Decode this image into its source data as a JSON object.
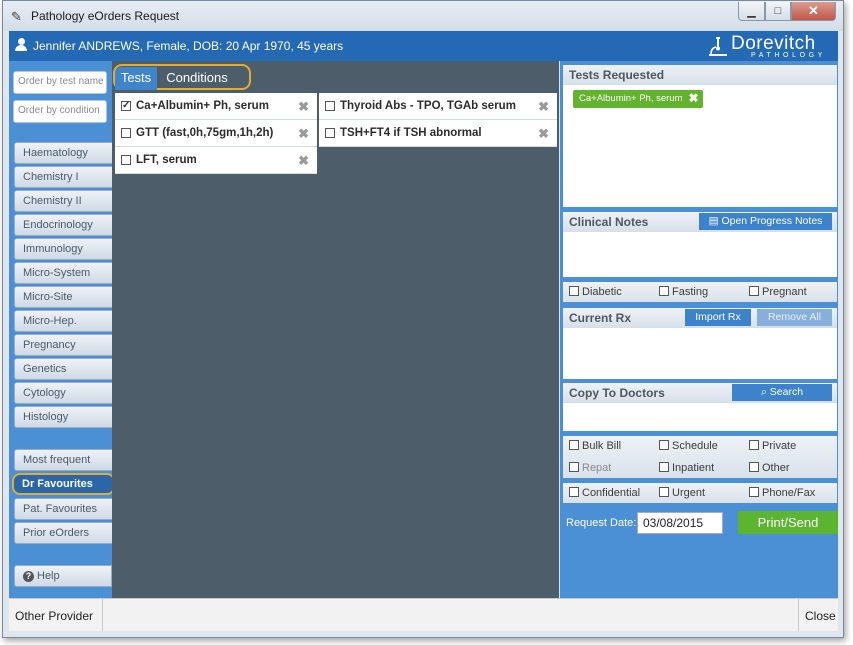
{
  "window": {
    "title": "Pathology eOrders Request",
    "minimize": "▁",
    "maximize": "□",
    "close": "✕"
  },
  "patient": {
    "summary": "Jennifer ANDREWS, Female, DOB: 20 Apr 1970, 45 years"
  },
  "logo": {
    "name": "Dorevitch",
    "sub": "PATHOLOGY"
  },
  "sidebar": {
    "search_test_placeholder": "Order by test name",
    "search_condition_placeholder": "Order by condition",
    "categories": [
      "Haematology",
      "Chemistry I",
      "Chemistry II",
      "Endocrinology",
      "Immunology",
      "Micro-System",
      "Micro-Site",
      "Micro-Hep.",
      "Pregnancy",
      "Genetics",
      "Cytology",
      "Histology"
    ],
    "lists": [
      "Most frequent",
      "Dr Favourites",
      "Pat. Favourites",
      "Prior eOrders"
    ],
    "active_list": "Dr Favourites",
    "help": "Help"
  },
  "tabs": {
    "tests": "Tests",
    "conditions": "Conditions"
  },
  "favourite_tests": [
    {
      "label": "Ca+Albumin+ Ph, serum",
      "checked": true
    },
    {
      "label": "GTT (fast,0h,75gm,1h,2h)",
      "checked": false
    },
    {
      "label": "LFT, serum",
      "checked": false
    },
    {
      "label": "Thyroid Abs - TPO, TGAb serum",
      "checked": false
    },
    {
      "label": "TSH+FT4 if TSH abnormal",
      "checked": false
    }
  ],
  "right_panel": {
    "tests_requested_title": "Tests Requested",
    "requested_chip": "Ca+Albumin+ Ph, serum",
    "clinical_notes_title": "Clinical Notes",
    "open_progress_notes": "Open Progress Notes",
    "flags": [
      "Diabetic",
      "Fasting",
      "Pregnant"
    ],
    "current_rx_title": "Current Rx",
    "import_rx": "Import Rx",
    "remove_all": "Remove All",
    "copy_to_doctors_title": "Copy To Doctors",
    "search": "Search",
    "billing": [
      "Bulk Bill",
      "Schedule",
      "Private",
      "Repat",
      "Inpatient",
      "Other"
    ],
    "options": [
      "Confidential",
      "Urgent",
      "Phone/Fax"
    ],
    "request_date_label": "Request Date:",
    "request_date": "03/08/2015",
    "print_send": "Print/Send"
  },
  "statusbar": {
    "other_provider": "Other Provider",
    "close": "Close"
  },
  "colors": {
    "brand_blue": "#2369b4",
    "sidebar_blue": "#4b8fd5",
    "workspace": "#4e5d6a",
    "highlight": "#e0ad35",
    "chip_green": "#63b32e",
    "print_green": "#5cb531"
  }
}
